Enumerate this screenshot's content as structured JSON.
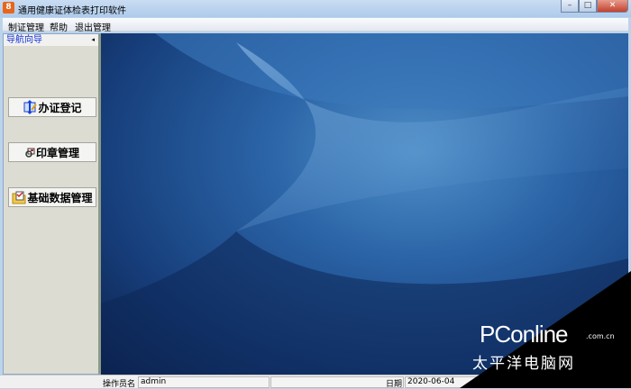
{
  "window": {
    "title": "通用健康证体检表打印软件",
    "icon_text": "8",
    "minimize": "–",
    "maximize": "□",
    "close": "✕"
  },
  "menu": [
    "制证管理",
    "帮助",
    "退出管理"
  ],
  "nav": {
    "header": "导航向导",
    "collapse": "◂",
    "items": [
      {
        "label": "办证登记"
      },
      {
        "label": "印章管理"
      },
      {
        "label": "基础数据管理"
      }
    ]
  },
  "status": {
    "operator_label": "操作员名",
    "operator": "admin",
    "date_label": "日期",
    "date": "2020-06-04"
  },
  "watermark": {
    "brand": "PConline",
    "domain": ".com.cn",
    "cn": "太平洋电脑网"
  }
}
